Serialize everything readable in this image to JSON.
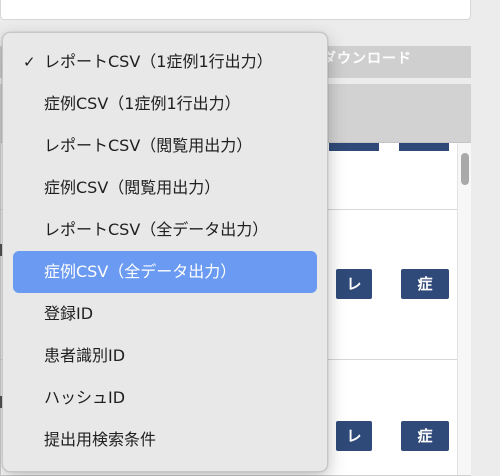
{
  "background": {
    "section_header_text": "ダウンロード",
    "row_buttons": [
      {
        "report_label": "レ",
        "case_label": "症"
      },
      {
        "report_label": "レ",
        "case_label": "症"
      }
    ]
  },
  "dropdown": {
    "selected_index": 0,
    "highlighted_index": 5,
    "items": [
      {
        "label": "レポートCSV（1症例1行出力）",
        "checked": true
      },
      {
        "label": "症例CSV（1症例1行出力）",
        "checked": false
      },
      {
        "label": "レポートCSV（閲覧用出力）",
        "checked": false
      },
      {
        "label": "症例CSV（閲覧用出力）",
        "checked": false
      },
      {
        "label": "レポートCSV（全データ出力）",
        "checked": false
      },
      {
        "label": "症例CSV（全データ出力）",
        "checked": false
      },
      {
        "label": "登録ID",
        "checked": false
      },
      {
        "label": "患者識別ID",
        "checked": false
      },
      {
        "label": "ハッシュID",
        "checked": false
      },
      {
        "label": "提出用検索条件",
        "checked": false
      }
    ],
    "checkmark_glyph": "✓"
  },
  "colors": {
    "highlight": "#6a9af2",
    "navy_button": "#2f4a78",
    "section_header": "#cfcfcf"
  }
}
